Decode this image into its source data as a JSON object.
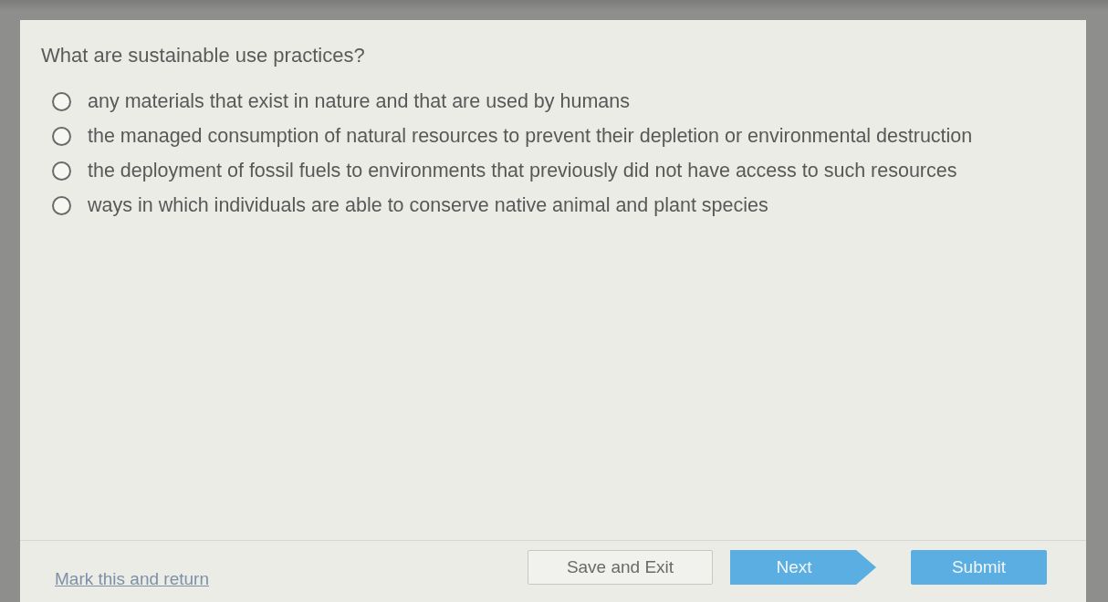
{
  "question": {
    "prompt": "What are sustainable use practices?"
  },
  "options": [
    {
      "label": "any materials that exist in nature and that are used by humans",
      "selected": false
    },
    {
      "label": "the managed consumption of natural resources to prevent their depletion or environmental destruction",
      "selected": false
    },
    {
      "label": "the deployment of fossil fuels to environments that previously did not have access to such resources",
      "selected": false
    },
    {
      "label": "ways in which individuals are able to conserve native animal and plant species",
      "selected": false
    }
  ],
  "footer": {
    "mark_link": "Mark this and return",
    "buttons": [
      {
        "label": "Save and Exit",
        "kind": "secondary"
      },
      {
        "label": "Next",
        "kind": "next"
      },
      {
        "label": "Submit",
        "kind": "primary"
      }
    ]
  }
}
